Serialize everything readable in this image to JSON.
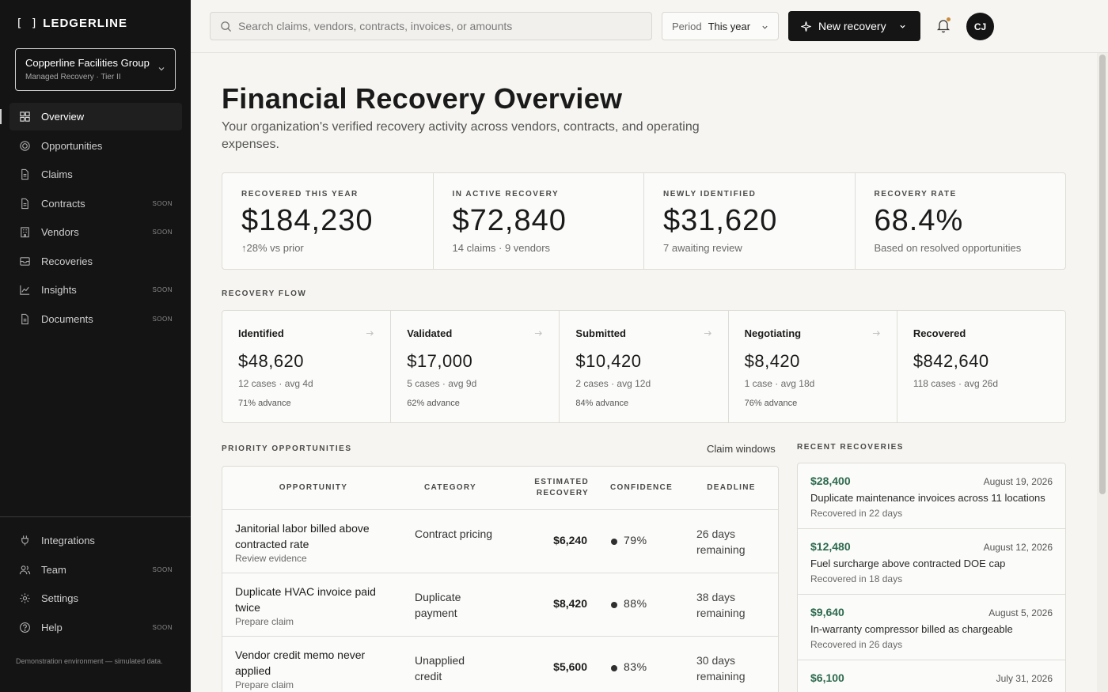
{
  "brand": {
    "mark": "[ ]",
    "name": "LEDGERLINE"
  },
  "org": {
    "name": "Copperline Facilities Group",
    "sub": "Managed Recovery · Tier II"
  },
  "nav": [
    {
      "label": "Overview",
      "icon": "grid-icon",
      "soon": ""
    },
    {
      "label": "Opportunities",
      "icon": "target-icon",
      "soon": ""
    },
    {
      "label": "Claims",
      "icon": "document-icon",
      "soon": ""
    },
    {
      "label": "Contracts",
      "icon": "document-icon",
      "soon": "SOON"
    },
    {
      "label": "Vendors",
      "icon": "building-icon",
      "soon": "SOON"
    },
    {
      "label": "Recoveries",
      "icon": "inbox-icon",
      "soon": ""
    },
    {
      "label": "Insights",
      "icon": "chart-icon",
      "soon": "SOON"
    },
    {
      "label": "Documents",
      "icon": "document-icon",
      "soon": "SOON"
    }
  ],
  "nav_bottom": [
    {
      "label": "Integrations",
      "icon": "plug-icon",
      "soon": ""
    },
    {
      "label": "Team",
      "icon": "users-icon",
      "soon": "SOON"
    },
    {
      "label": "Settings",
      "icon": "gear-icon",
      "soon": ""
    },
    {
      "label": "Help",
      "icon": "help-icon",
      "soon": "SOON"
    }
  ],
  "demo_note": "Demonstration environment — simulated data.",
  "search": {
    "placeholder": "Search claims, vendors, contracts, invoices, or amounts"
  },
  "period": {
    "label": "Period",
    "value": "This year"
  },
  "new_recovery": "New recovery",
  "user_initials": "CJ",
  "page": {
    "title": "Financial Recovery Overview",
    "subtitle": "Your organization's verified recovery activity across vendors, contracts, and operating expenses."
  },
  "kpis": [
    {
      "label": "RECOVERED THIS YEAR",
      "value": "$184,230",
      "note": "↑28% vs prior"
    },
    {
      "label": "IN ACTIVE RECOVERY",
      "value": "$72,840",
      "note": "14 claims · 9 vendors"
    },
    {
      "label": "NEWLY IDENTIFIED",
      "value": "$31,620",
      "note": "7 awaiting review"
    },
    {
      "label": "RECOVERY RATE",
      "value": "68.4%",
      "note": "Based on resolved opportunities"
    }
  ],
  "flow_label": "RECOVERY FLOW",
  "flow": [
    {
      "name": "Identified",
      "value": "$48,620",
      "meta": "12 cases · avg 4d",
      "advance": "71% advance"
    },
    {
      "name": "Validated",
      "value": "$17,000",
      "meta": "5 cases · avg 9d",
      "advance": "62% advance"
    },
    {
      "name": "Submitted",
      "value": "$10,420",
      "meta": "2 cases · avg 12d",
      "advance": "84% advance"
    },
    {
      "name": "Negotiating",
      "value": "$8,420",
      "meta": "1 case · avg 18d",
      "advance": "76% advance"
    },
    {
      "name": "Recovered",
      "value": "$842,640",
      "meta": "118 cases · avg 26d",
      "advance": ""
    }
  ],
  "priority_label": "PRIORITY OPPORTUNITIES",
  "claim_windows": "Claim windows",
  "table": {
    "headers": {
      "opportunity": "OPPORTUNITY",
      "category": "CATEGORY",
      "estimated": "ESTIMATED RECOVERY",
      "confidence": "CONFIDENCE",
      "deadline": "DEADLINE"
    },
    "rows": [
      {
        "title": "Janitorial labor billed above contracted rate",
        "action": "Review evidence",
        "category": "Contract pricing",
        "amount": "$6,240",
        "confidence": "79%",
        "deadline": "26 days remaining"
      },
      {
        "title": "Duplicate HVAC invoice paid twice",
        "action": "Prepare claim",
        "category": "Duplicate payment",
        "amount": "$8,420",
        "confidence": "88%",
        "deadline": "38 days remaining"
      },
      {
        "title": "Vendor credit memo never applied",
        "action": "Prepare claim",
        "category": "Unapplied credit",
        "amount": "$5,600",
        "confidence": "83%",
        "deadline": "30 days remaining"
      }
    ]
  },
  "recent_label": "RECENT RECOVERIES",
  "recent": [
    {
      "amount": "$28,400",
      "date": "August 19, 2026",
      "desc": "Duplicate maintenance invoices across 11 locations",
      "time": "Recovered in 22 days"
    },
    {
      "amount": "$12,480",
      "date": "August 12, 2026",
      "desc": "Fuel surcharge above contracted DOE cap",
      "time": "Recovered in 18 days"
    },
    {
      "amount": "$9,640",
      "date": "August 5, 2026",
      "desc": "In-warranty compressor billed as chargeable",
      "time": "Recovered in 26 days"
    },
    {
      "amount": "$6,100",
      "date": "July 31, 2026",
      "desc": "",
      "time": ""
    }
  ]
}
